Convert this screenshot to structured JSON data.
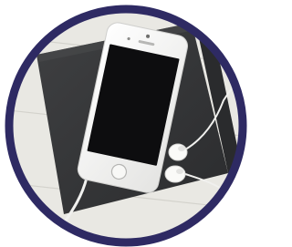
{
  "image": {
    "subject": "smartphone-with-earphones-on-notebook",
    "frame_shape": "circle",
    "colors": {
      "frame_ring": "#2e2a63",
      "frame_outer": "#ffffff",
      "wood_light": "#e9e8e3",
      "wood_grain": "#d3d2cc",
      "notebook": "#3a3b3d",
      "notebook_dark": "#2c2d2f",
      "phone_body": "#f4f4f2",
      "phone_screen": "#0d0d0f",
      "earphones": "#fafaf8",
      "cable": "#f0f0ee"
    },
    "icons": [
      "phone-camera-icon",
      "phone-speaker-icon",
      "home-button-icon"
    ]
  }
}
